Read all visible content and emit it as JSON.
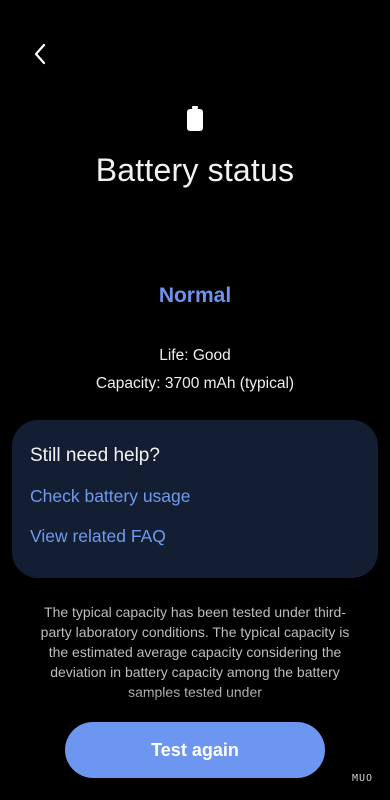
{
  "header": {
    "back_icon": "chevron-left-icon"
  },
  "status": {
    "icon": "battery-icon",
    "title": "Battery status",
    "state": "Normal",
    "state_color": "#6d93ee",
    "life": "Life: Good",
    "capacity": "Capacity: 3700 mAh (typical)"
  },
  "help_card": {
    "title": "Still need help?",
    "links": [
      {
        "label": "Check battery usage"
      },
      {
        "label": "View related FAQ"
      }
    ],
    "link_color": "#6e9aee",
    "background": "#141e33"
  },
  "disclaimer": "The typical capacity has been tested under third-party laboratory conditions. The typical capacity is the estimated average capacity considering the deviation in battery capacity among the battery samples tested under",
  "actions": {
    "test_again_label": "Test again",
    "button_color": "#6d96f0"
  },
  "watermark": "MUO"
}
